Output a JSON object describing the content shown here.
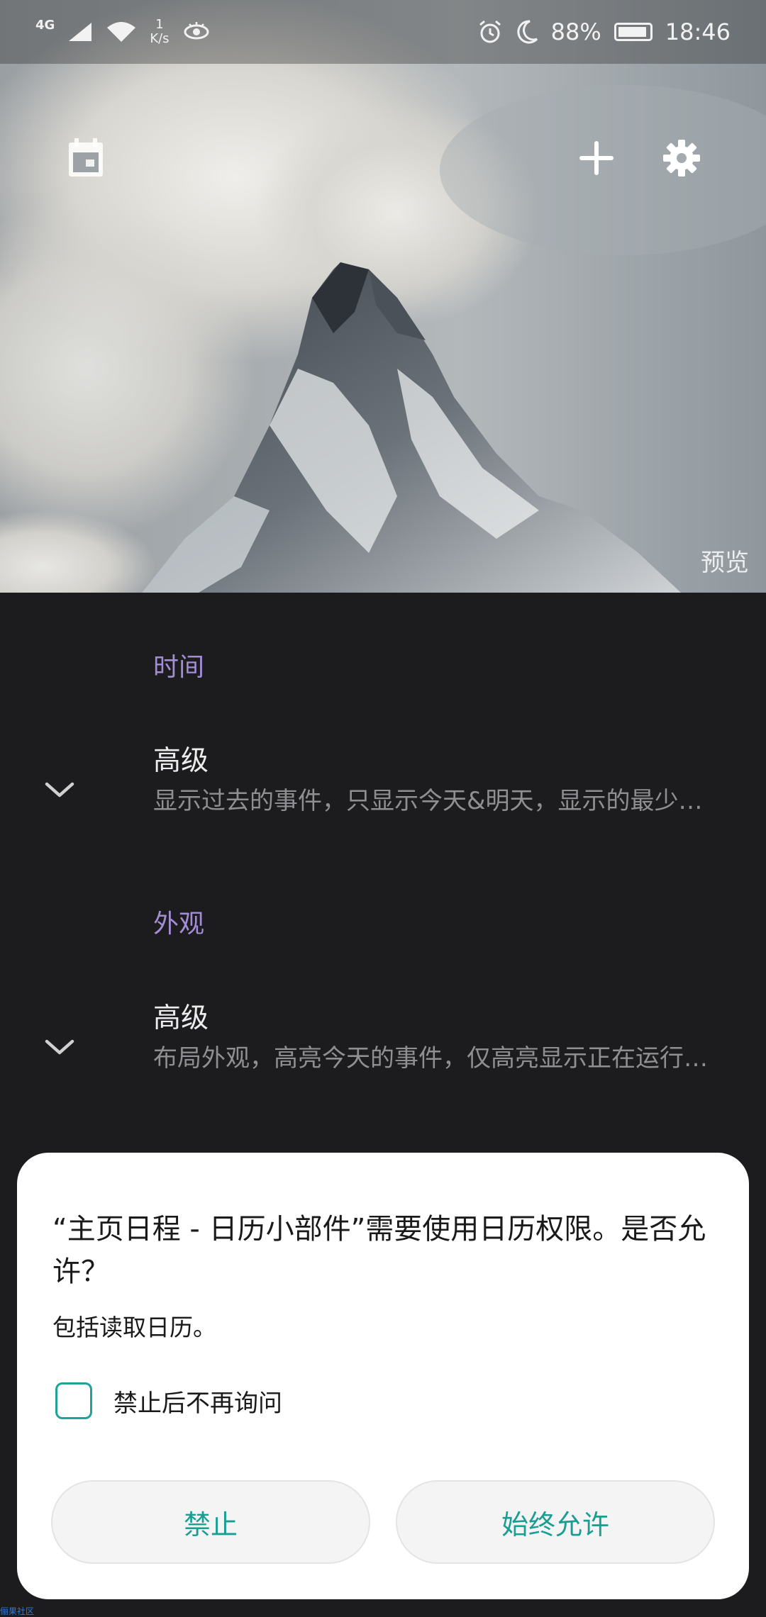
{
  "status_bar": {
    "network": "4G",
    "speed_value": "1",
    "speed_unit": "K/s",
    "battery": "88%",
    "time": "18:46",
    "icons": [
      "signal-icon",
      "wifi-icon",
      "eye-icon",
      "alarm-icon",
      "moon-icon",
      "battery-icon"
    ]
  },
  "hero": {
    "icons": {
      "left": "calendar-icon",
      "add": "plus-icon",
      "settings": "gear-icon"
    },
    "preview_label": "预览"
  },
  "sections": [
    {
      "header": "时间",
      "row": {
        "title": "高级",
        "subtitle": "显示过去的事件，只显示今天&明天，显示的最少天数，..."
      }
    },
    {
      "header": "外观",
      "row": {
        "title": "高级",
        "subtitle": "布局外观，高亮今天的事件，仅高亮显示正在运行的事件..."
      }
    }
  ],
  "dialog": {
    "title": "“主页日程 - 日历小部件”需要使用日历权限。是否允许？",
    "description": "包括读取日历。",
    "checkbox_label": "禁止后不再询问",
    "deny_label": "禁止",
    "allow_label": "始终允许"
  },
  "watermark": "俪果社区",
  "colors": {
    "accent_purple": "#a38ed6",
    "dialog_button_text": "#1a9e92",
    "background": "#1c1c1e"
  }
}
